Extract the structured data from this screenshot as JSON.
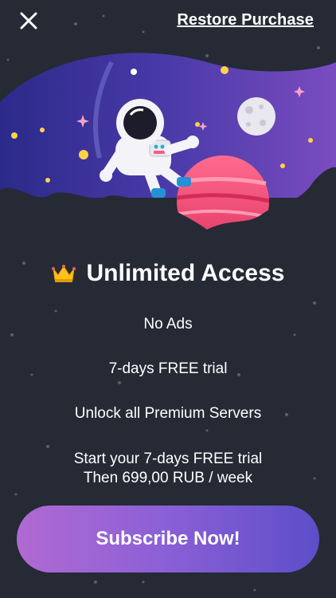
{
  "header": {
    "close_icon": "close-icon",
    "restore_label": "Restore Purchase"
  },
  "offer": {
    "crown_icon": "crown-icon",
    "title": "Unlimited Access",
    "features": [
      "No Ads",
      "7-days FREE trial",
      "Unlock all Premium Servers"
    ],
    "trial_line": "Start your 7-days FREE trial",
    "price_line": "Then 699,00 RUB / week"
  },
  "cta": {
    "subscribe_label": "Subscribe Now!"
  },
  "colors": {
    "background": "#252a35",
    "button_gradient_start": "#b06ad2",
    "button_gradient_end": "#5c4ec8",
    "planet": "#f0507a"
  }
}
